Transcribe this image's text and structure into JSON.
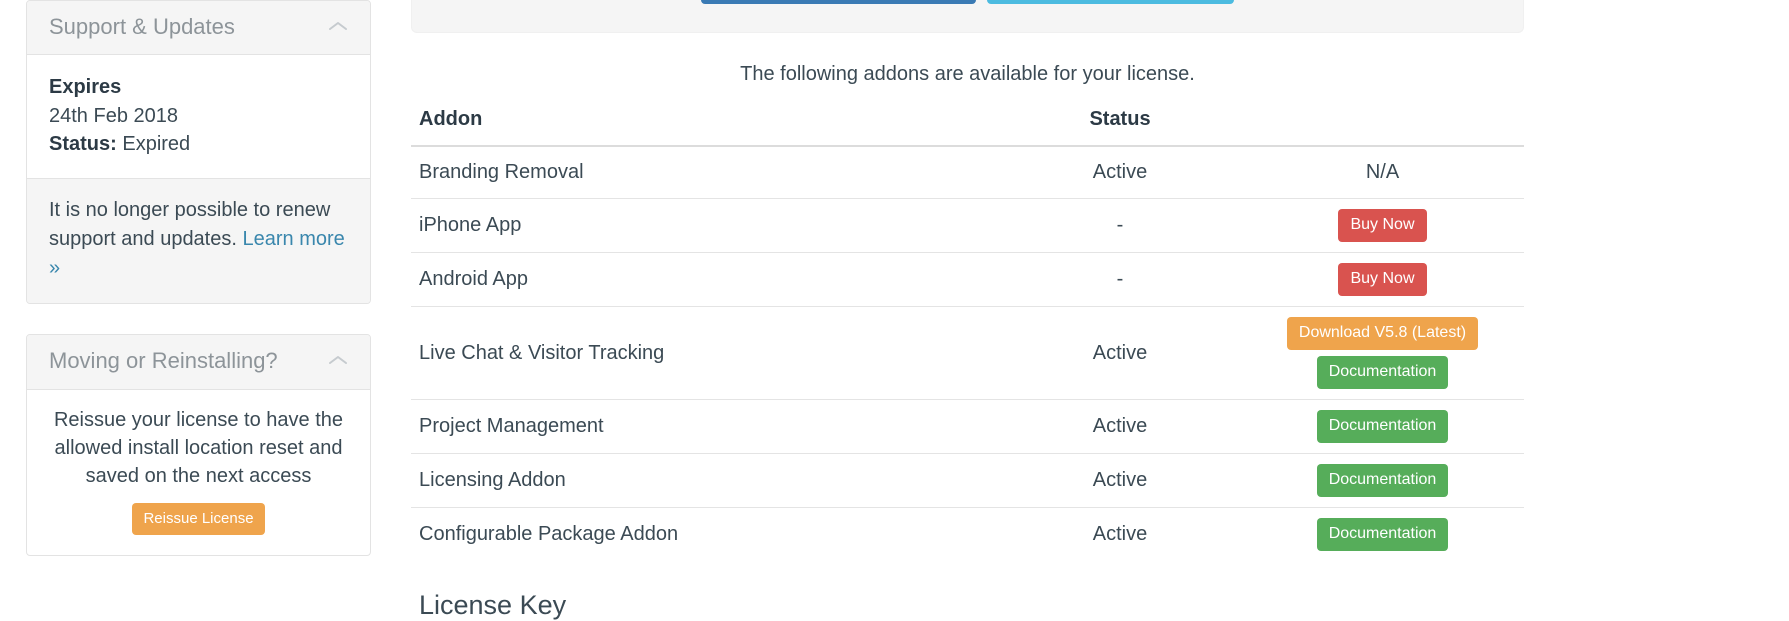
{
  "sidebar": {
    "panels": [
      {
        "title": "Support & Updates",
        "collapse_icon": "chevron-up-icon",
        "expires_label": "Expires",
        "expires_date": "24th Feb 2018",
        "status_label": "Status:",
        "status_value": "Expired",
        "footer_text": "It is no longer possible to renew support and updates. ",
        "footer_link": "Learn more »"
      },
      {
        "title": "Moving or Reinstalling?",
        "collapse_icon": "chevron-up-icon",
        "body_text": "Reissue your license to have the allowed install location reset and saved on the next access",
        "button_label": "Reissue License"
      }
    ]
  },
  "main": {
    "top_buttons": [
      {
        "name": "primary-action-button",
        "color": "#3a7ab4"
      },
      {
        "name": "info-action-button",
        "color": "#4cbbe0"
      }
    ],
    "intro": "The following addons are available for your license.",
    "table": {
      "headers": [
        "Addon",
        "Status",
        ""
      ],
      "rows": [
        {
          "addon": "Branding Removal",
          "status": "Active",
          "action_text": "N/A",
          "actions": []
        },
        {
          "addon": "iPhone App",
          "status": "-",
          "action_text": "",
          "actions": [
            {
              "label": "Buy Now",
              "style": "danger"
            }
          ]
        },
        {
          "addon": "Android App",
          "status": "-",
          "action_text": "",
          "actions": [
            {
              "label": "Buy Now",
              "style": "danger"
            }
          ]
        },
        {
          "addon": "Live Chat & Visitor Tracking",
          "status": "Active",
          "action_text": "",
          "actions": [
            {
              "label": "Download V5.8 (Latest)",
              "style": "download"
            },
            {
              "label": "Documentation",
              "style": "success"
            }
          ]
        },
        {
          "addon": "Project Management",
          "status": "Active",
          "action_text": "",
          "actions": [
            {
              "label": "Documentation",
              "style": "success"
            }
          ]
        },
        {
          "addon": "Licensing Addon",
          "status": "Active",
          "action_text": "",
          "actions": [
            {
              "label": "Documentation",
              "style": "success"
            }
          ]
        },
        {
          "addon": "Configurable Package Addon",
          "status": "Active",
          "action_text": "",
          "actions": [
            {
              "label": "Documentation",
              "style": "success"
            }
          ]
        }
      ]
    },
    "license_key_heading": "License Key"
  },
  "colors": {
    "danger": "#d9534f",
    "success": "#56ad5a",
    "warning": "#efa44c",
    "primary": "#3a7ab4",
    "info": "#4cbbe0",
    "link": "#3a87ad"
  }
}
